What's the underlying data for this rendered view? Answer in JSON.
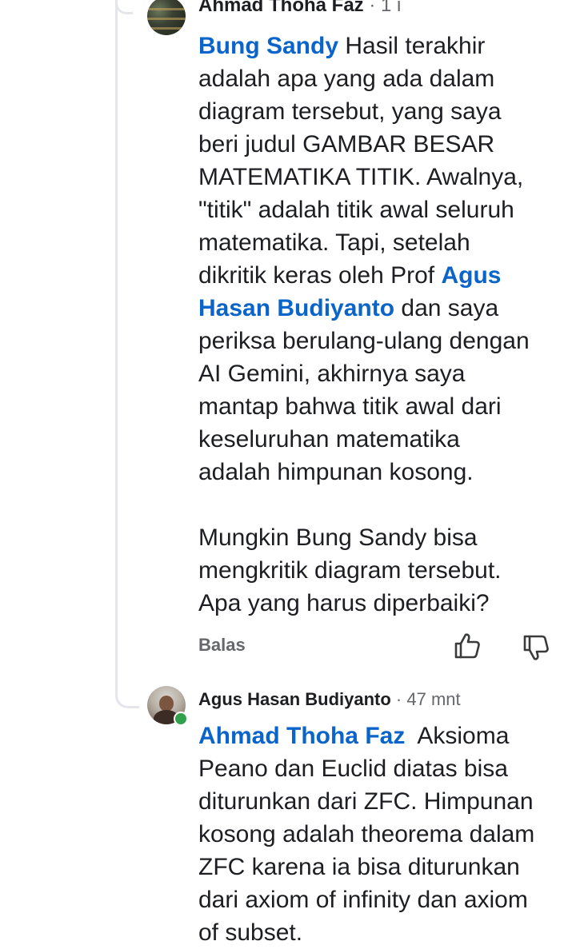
{
  "comment_1": {
    "author_cut": "Ahmad Thoha Faz",
    "time_cut": "· 1 j",
    "mention_1": "Bung Sandy",
    "text_1": " Hasil terakhir\nadalah apa yang ada dalam\ndiagram tersebut, yang saya\nberi judul GAMBAR BESAR\nMATEMATIKA TITIK. Awalnya,\n\"titik\" adalah titik awal seluruh\nmatematika. Tapi, setelah\ndikritik keras oleh Prof ",
    "mention_2": "Agus\nHasan Budiyanto",
    "text_2": " dan saya\nperiksa berulang-ulang dengan\nAI Gemini, akhirnya saya\nmantap bahwa titik awal dari\nkeseluruhan matematika\nadalah himpunan kosong.\n\nMungkin Bung Sandy bisa\nmengkritik diagram tersebut.\nApa yang harus diperbaiki?",
    "reply_label": "Balas",
    "like_icon": "thumbs-up-icon",
    "dislike_icon": "thumbs-down-icon"
  },
  "comment_2": {
    "author": "Agus Hasan Budiyanto",
    "time": " · 47 mnt",
    "mention": "Ahmad Thoha Faz",
    "text": "  Aksioma\nPeano dan Euclid diatas bisa\nditurunkan dari ZFC. Himpunan\nkosong adalah theorema dalam\nZFC karena ia bisa diturunkan\ndari axiom of infinity dan axiom\nof subset."
  },
  "colors": {
    "mention": "#0a64c9",
    "online": "#31a24c",
    "meta": "#65676b"
  }
}
